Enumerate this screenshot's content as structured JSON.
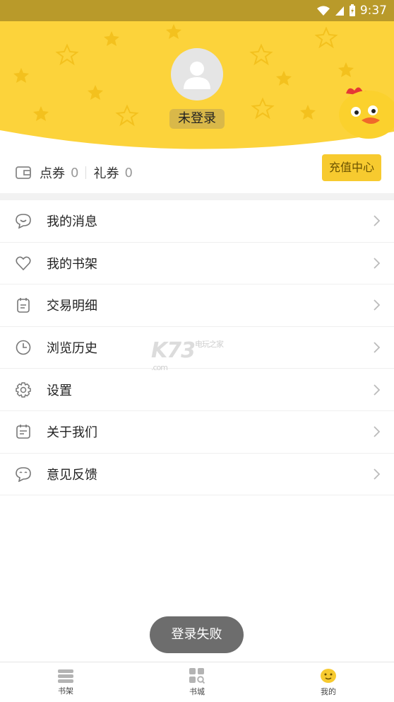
{
  "status_bar": {
    "time": "9:37"
  },
  "header": {
    "login_status": "未登录"
  },
  "balance": {
    "points_label": "点券",
    "points_value": "0",
    "gift_label": "礼券",
    "gift_value": "0",
    "recharge_label": "充值中心"
  },
  "menu": [
    {
      "label": "我的消息",
      "icon": "message-icon"
    },
    {
      "label": "我的书架",
      "icon": "heart-icon"
    },
    {
      "label": "交易明细",
      "icon": "receipt-icon"
    },
    {
      "label": "浏览历史",
      "icon": "clock-icon"
    },
    {
      "label": "设置",
      "icon": "gear-icon"
    },
    {
      "label": "关于我们",
      "icon": "info-card-icon"
    },
    {
      "label": "意见反馈",
      "icon": "feedback-icon"
    }
  ],
  "watermark": {
    "main": "K73",
    "sub": "电玩之家",
    "domain": ".com"
  },
  "toast": "登录失败",
  "bottom_nav": [
    {
      "label": "书架",
      "icon": "bookshelf-icon"
    },
    {
      "label": "书城",
      "icon": "bookstore-icon"
    },
    {
      "label": "我的",
      "icon": "profile-icon"
    }
  ],
  "colors": {
    "accent": "#f7ca2f",
    "header_yellow": "#fcd33b",
    "status_bar": "#b99a2a"
  }
}
